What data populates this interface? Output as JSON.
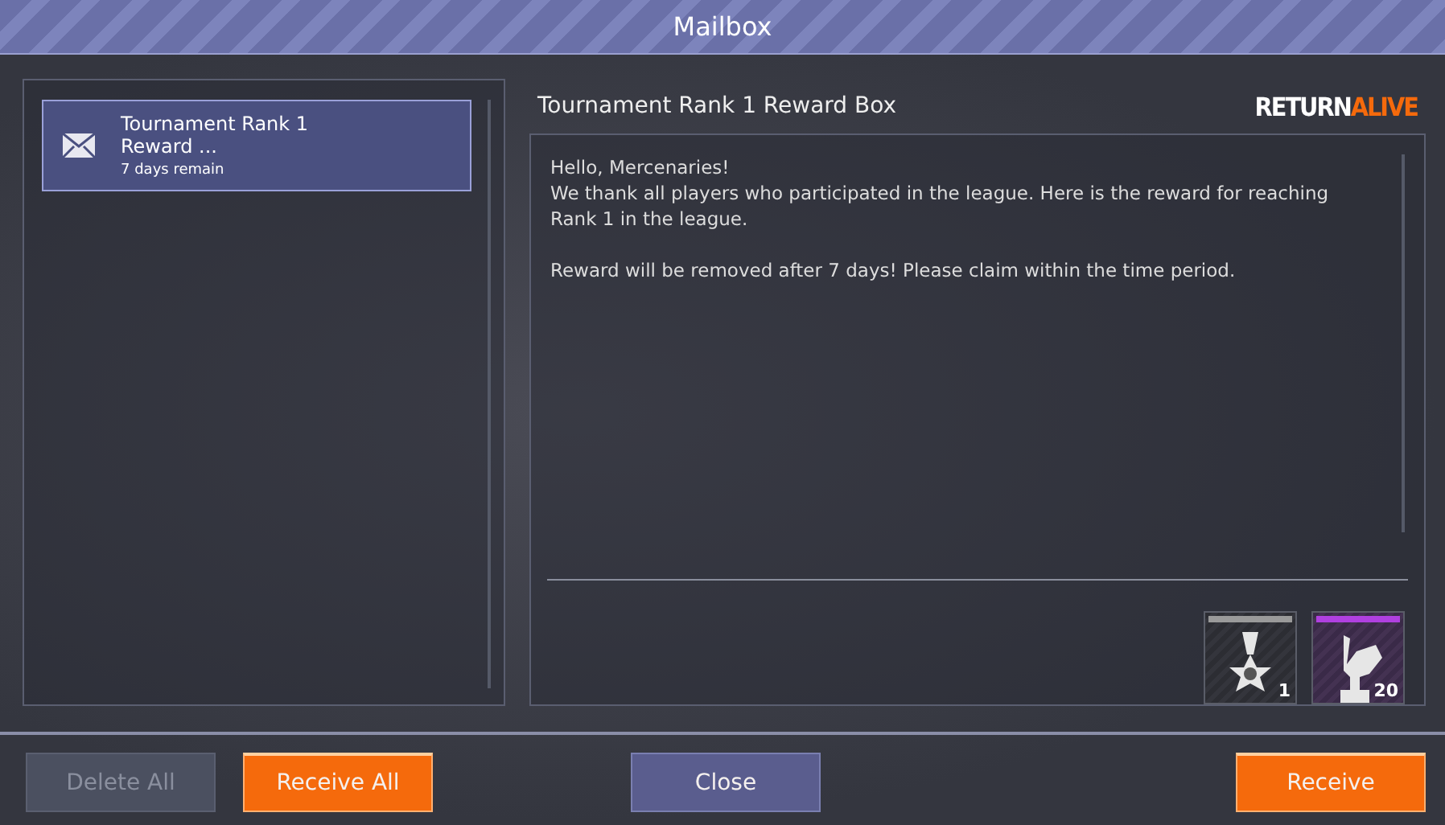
{
  "window": {
    "title": "Mailbox"
  },
  "mail_list": [
    {
      "title": "Tournament Rank 1 Reward ...",
      "remaining": "7 days remain",
      "selected": true
    }
  ],
  "message": {
    "title": "Tournament Rank 1 Reward Box",
    "logo": [
      "RETURN",
      "ALIVE"
    ],
    "body": [
      "Hello, Mercenaries!\nWe thank all players who participated in the league. Here is the reward for reaching Rank 1 in the league.",
      "Reward will be removed after 7 days! Please claim within the time period."
    ],
    "rewards": [
      {
        "count": "1",
        "color": "#9a9a9a",
        "kind": "medal"
      },
      {
        "count": "20",
        "color": "#b040e0",
        "kind": "statue"
      }
    ]
  },
  "buttons": [
    {
      "label": "Delete All",
      "kind": "gray",
      "disabled": true
    },
    {
      "label": "Receive All",
      "kind": "orange",
      "disabled": false
    },
    {
      "label": "Close",
      "kind": "blue",
      "disabled": false
    },
    {
      "label": "Receive",
      "kind": "orange",
      "disabled": false
    }
  ]
}
